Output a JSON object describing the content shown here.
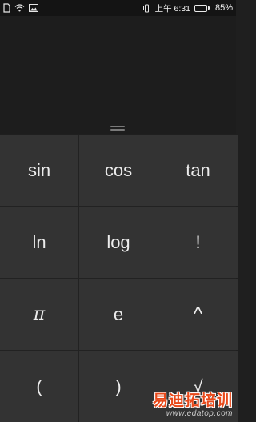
{
  "status_bar": {
    "time": "上午 6:31",
    "battery_percent_label": "85%",
    "battery_level": 0.85,
    "left_icons": [
      "sim-icon",
      "wifi-icon",
      "gallery-icon"
    ],
    "right_icons": [
      "vibrate-icon",
      "battery-icon"
    ]
  },
  "keypad": {
    "keys": [
      "sin",
      "cos",
      "tan",
      "ln",
      "log",
      "!",
      "π",
      "e",
      "^",
      "(",
      ")",
      "√"
    ]
  },
  "watermark": {
    "text": "易迪拓培训",
    "url": "www.edatop.com"
  },
  "colors": {
    "background": "#1f1f1f",
    "key_background": "#333333",
    "key_text": "#ececec",
    "watermark": "#e8491a"
  }
}
